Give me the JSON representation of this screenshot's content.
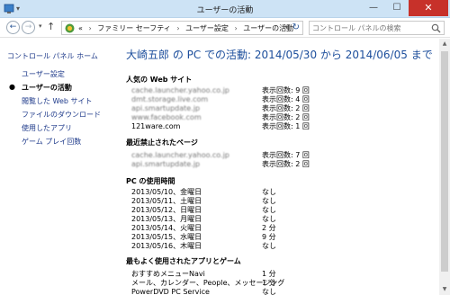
{
  "window": {
    "title": "ユーザーの活動",
    "minimize_glyph": "—",
    "maximize_glyph": "☐",
    "close_glyph": "✕"
  },
  "nav": {
    "back_glyph": "←",
    "forward_glyph": "→",
    "up_glyph": "↑",
    "breadcrumb_prefix": "«",
    "breadcrumbs": [
      "ファミリー セーフティ",
      "ユーザー設定",
      "ユーザーの活動"
    ],
    "search_placeholder": "コントロール パネルの検索"
  },
  "sidebar": {
    "home": "コントロール パネル ホーム",
    "items": [
      {
        "label": "ユーザー設定",
        "active": false
      },
      {
        "label": "ユーザーの活動",
        "active": true
      },
      {
        "label": "閲覧した Web サイト",
        "active": false
      },
      {
        "label": "ファイルのダウンロード",
        "active": false
      },
      {
        "label": "使用したアプリ",
        "active": false
      },
      {
        "label": "ゲーム プレイ回数",
        "active": false
      }
    ]
  },
  "main": {
    "heading": "大崎五郎 の PC での活動: 2014/05/30 から 2014/06/05 まで",
    "websites": {
      "title": "人気の Web サイト",
      "rows": [
        {
          "site": "cache.launcher.yahoo.co.jp",
          "count": "表示回数: 9 回"
        },
        {
          "site": "dmt.storage.live.com",
          "count": "表示回数: 4 回"
        },
        {
          "site": "api.smartupdate.jp",
          "count": "表示回数: 2 回"
        },
        {
          "site": "www.facebook.com",
          "count": "表示回数: 2 回"
        },
        {
          "site": "121ware.com",
          "count": "表示回数: 1 回"
        }
      ]
    },
    "blocked": {
      "title": "最近禁止されたページ",
      "rows": [
        {
          "site": "cache.launcher.yahoo.co.jp",
          "count": "表示回数: 7 回"
        },
        {
          "site": "api.smartupdate.jp",
          "count": "表示回数: 2 回"
        }
      ]
    },
    "usage": {
      "title": "PC の使用時間",
      "rows": [
        {
          "date": "2013/05/10、金曜日",
          "time": "なし"
        },
        {
          "date": "2013/05/11、土曜日",
          "time": "なし"
        },
        {
          "date": "2013/05/12、日曜日",
          "time": "なし"
        },
        {
          "date": "2013/05/13、月曜日",
          "time": "なし"
        },
        {
          "date": "2013/05/14、火曜日",
          "time": "2 分"
        },
        {
          "date": "2013/05/15、水曜日",
          "time": "9 分"
        },
        {
          "date": "2013/05/16、木曜日",
          "time": "なし"
        }
      ]
    },
    "apps": {
      "title": "最もよく使用されたアプリとゲーム",
      "rows": [
        {
          "app": "おすすめメニューNavi",
          "time": "1 分"
        },
        {
          "app": "メール、カレンダー、People、メッセージング",
          "time": "1 分"
        },
        {
          "app": "PowerDVD PC Service",
          "time": "なし"
        }
      ]
    }
  }
}
